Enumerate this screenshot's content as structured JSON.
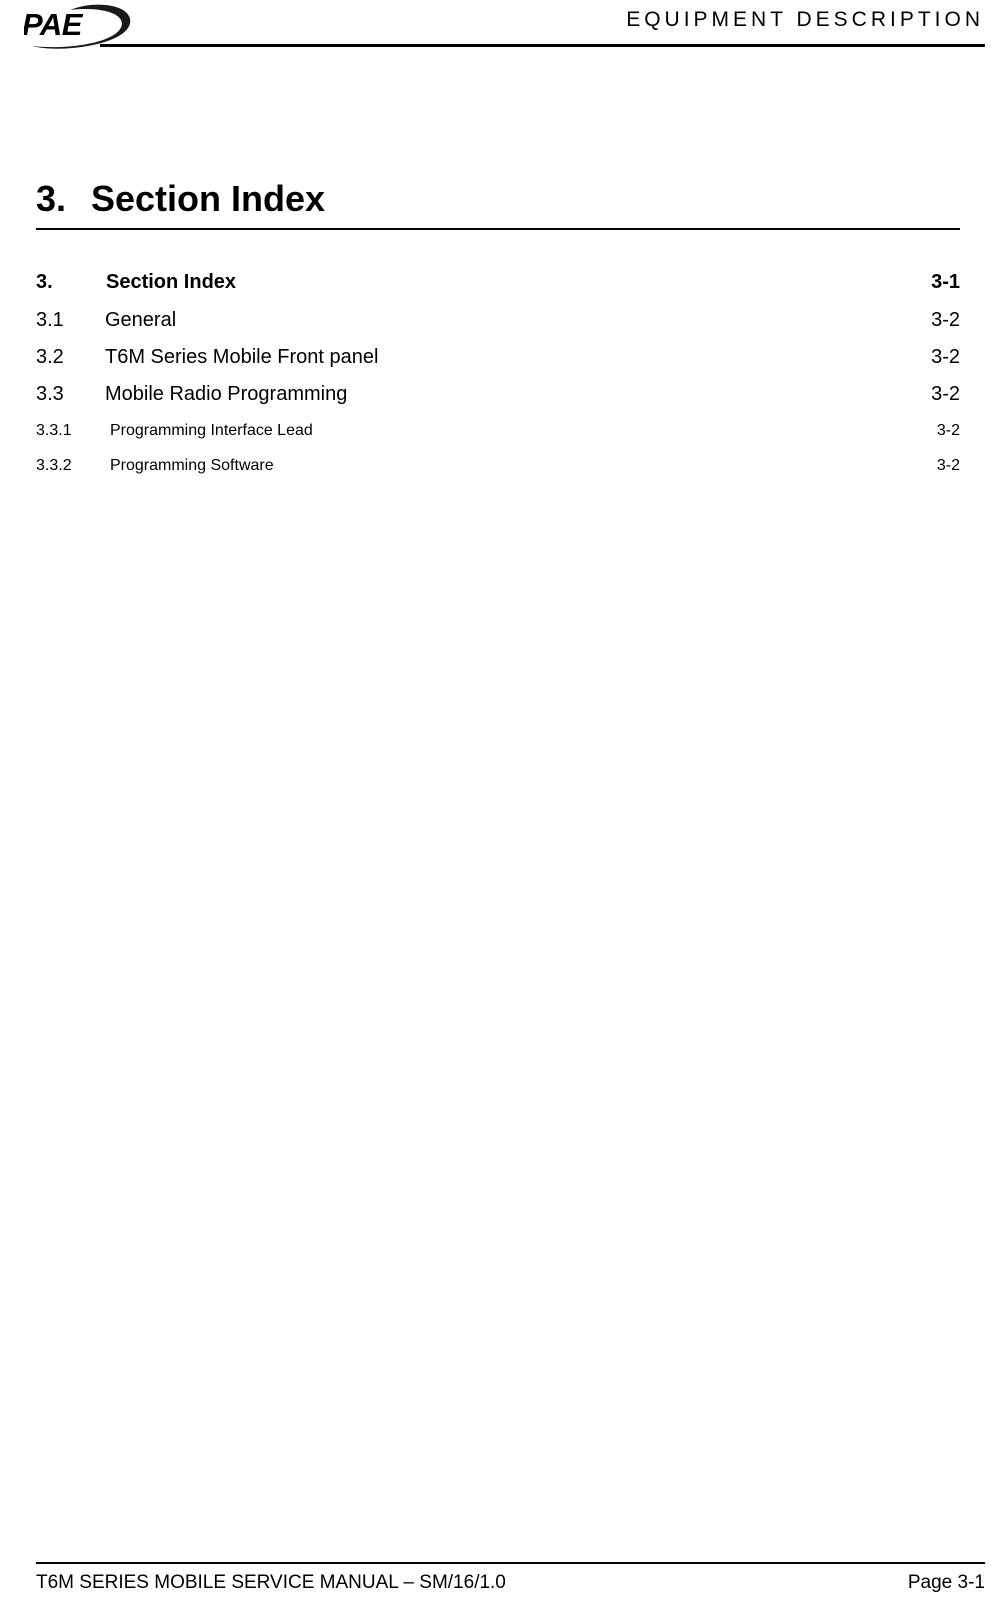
{
  "header": {
    "logo_text": "PAE",
    "logo_icon": "pae-swoosh-logo",
    "title": "EQUIPMENT DESCRIPTION"
  },
  "section": {
    "number": "3.",
    "title": "Section Index"
  },
  "toc": {
    "entries": [
      {
        "number": "3.",
        "label": "Section Index",
        "page": "3-1",
        "level": 1
      },
      {
        "number": "3.1",
        "label": "General",
        "page": "3-2",
        "level": 2
      },
      {
        "number": "3.2",
        "label": "T6M Series Mobile Front panel",
        "page": "3-2",
        "level": 2
      },
      {
        "number": "3.3",
        "label": "Mobile Radio Programming",
        "page": "3-2",
        "level": 2
      },
      {
        "number": "3.3.1",
        "label": "Programming Interface Lead",
        "page": "3-2",
        "level": 3
      },
      {
        "number": "3.3.2",
        "label": "Programming Software",
        "page": "3-2",
        "level": 3
      }
    ]
  },
  "footer": {
    "left": "T6M SERIES MOBILE SERVICE MANUAL – SM/16/1.0",
    "right": "Page 3-1"
  }
}
